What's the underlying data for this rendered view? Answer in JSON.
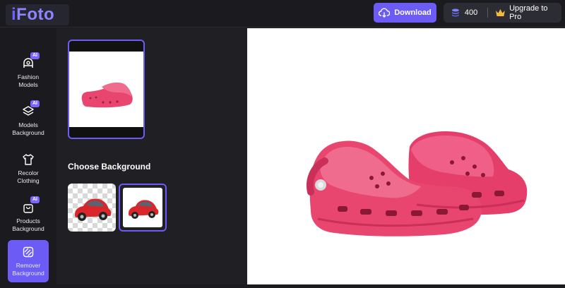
{
  "app": {
    "logo_i": "i",
    "logo_rest": "Foto"
  },
  "header": {
    "download_label": "Download",
    "credits": "400",
    "upgrade_label": "Upgrade to Pro"
  },
  "sidebar": {
    "items": [
      {
        "line1": "Fashion",
        "line2": "Models",
        "badge": "AI"
      },
      {
        "line1": "Models",
        "line2": "Background",
        "badge": "AI"
      },
      {
        "line1": "Recolor",
        "line2": "Clothing",
        "badge": ""
      },
      {
        "line1": "Products",
        "line2": "Background",
        "badge": "AI"
      },
      {
        "line1": "Remover",
        "line2": "Background",
        "badge": ""
      }
    ]
  },
  "panel": {
    "choose_title": "Choose Background"
  },
  "colors": {
    "accent": "#6c5cf5",
    "shoe": "#e8466f",
    "car": "#d9262a"
  }
}
